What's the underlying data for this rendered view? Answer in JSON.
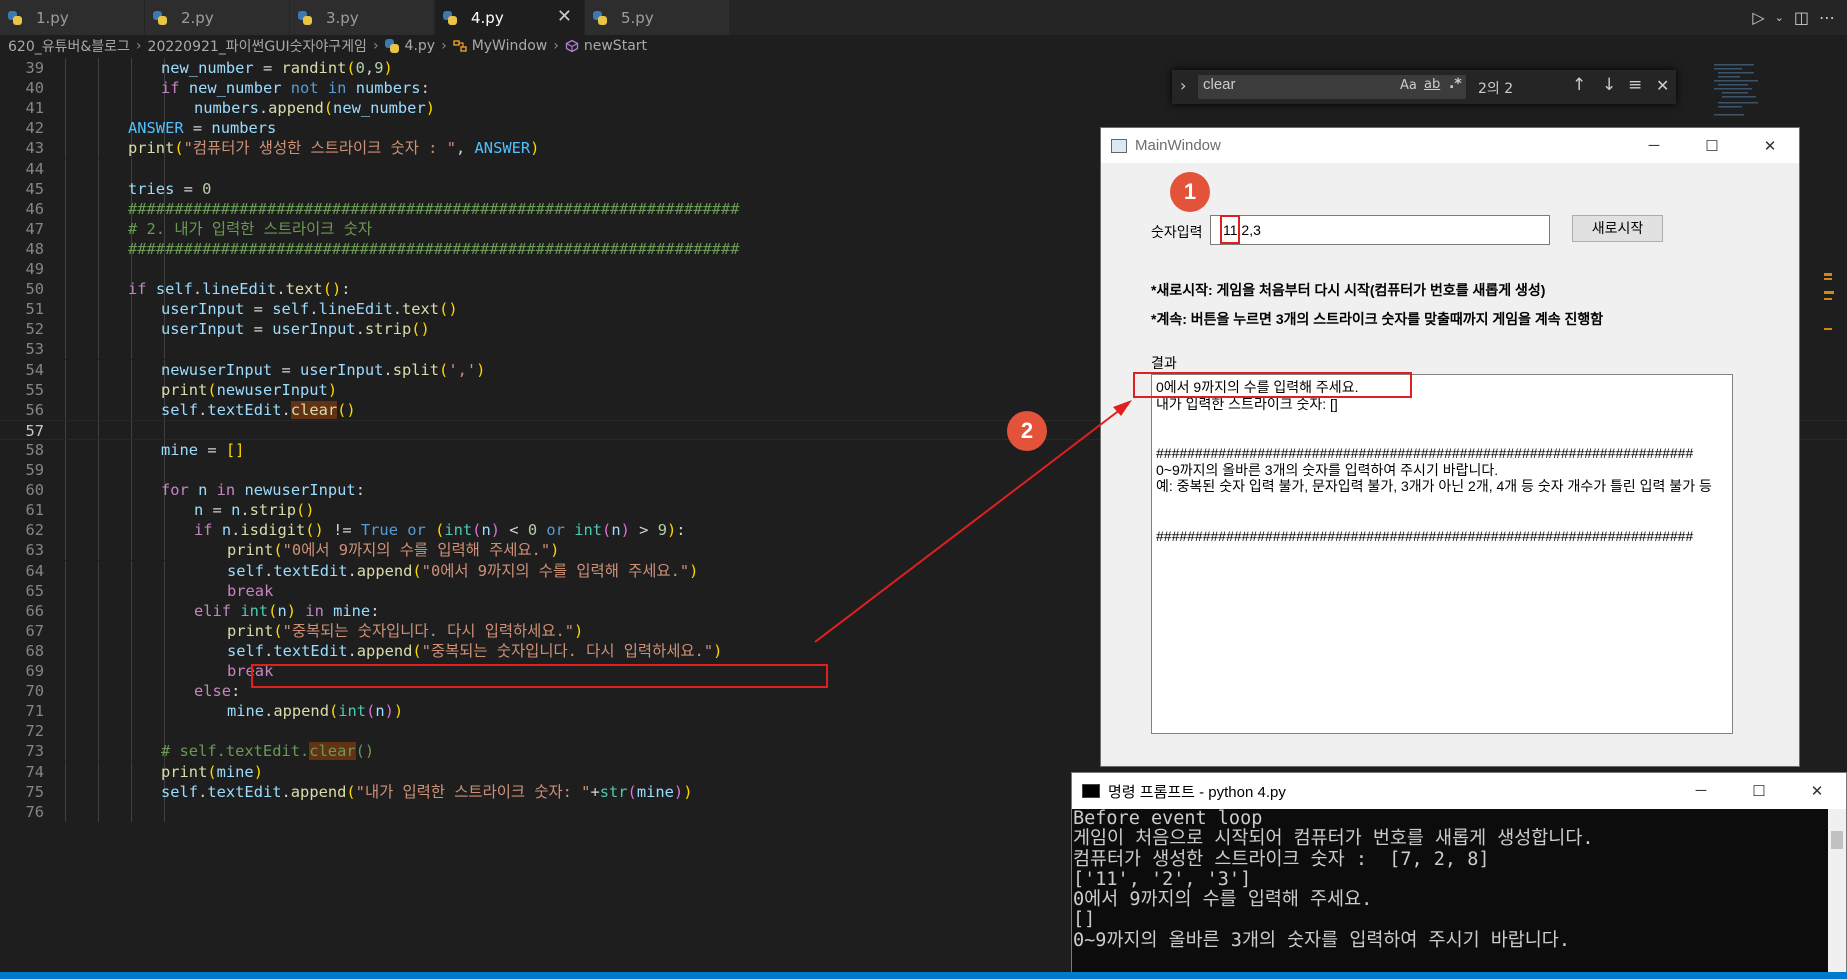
{
  "tabs": [
    {
      "label": "1.py",
      "active": false
    },
    {
      "label": "2.py",
      "active": false
    },
    {
      "label": "3.py",
      "active": false
    },
    {
      "label": "4.py",
      "active": true
    },
    {
      "label": "5.py",
      "active": false
    }
  ],
  "breadcrumb": {
    "folder": "620_유튜버&블로그",
    "subfolder": "20220921_파이썬GUI숫자야구게임",
    "file": "4.py",
    "class": "MyWindow",
    "method": "newStart"
  },
  "find": {
    "query": "clear",
    "match_case": "Aa",
    "whole_word": "ab",
    "regex": ".*",
    "count": "2의 2"
  },
  "qt": {
    "title": "MainWindow",
    "input_label": "숫자입력",
    "input_value": "11,2,3",
    "restart_button": "새로시작",
    "note1": "*새로시작: 게임을 처음부터 다시 시작(컴퓨터가 번호를 새롭게 생성)",
    "note2": "*계속: 버튼을 누르면 3개의 스트라이크 숫자를 맞출때까지 게임을 계속 진행함",
    "result_label": "결과",
    "result_lines": [
      "0에서 9까지의 수를 입력해 주세요.",
      "내가 입력한 스트라이크 숫자: []",
      "",
      "",
      "#####################################################################",
      "0~9까지의 올바른 3개의 숫자를 입력하여 주시기 바랍니다.",
      "예: 중복된 숫자 입력 불가, 문자입력 불가, 3개가 아닌 2개, 4개 등 숫자 개수가 틀린 입력 불가 등",
      "",
      "",
      "#####################################################################"
    ]
  },
  "cmd": {
    "title": "명령 프롬프트 - python  4.py",
    "lines": [
      "Before event loop",
      "게임이 처음으로 시작되어 컴퓨터가 번호를 새롭게 생성합니다.",
      "컴퓨터가 생성한 스트라이크 숫자 :  [7, 2, 8]",
      "['11', '2', '3']",
      "0에서 9까지의 수를 입력해 주세요.",
      "[]",
      "0~9까지의 올바른 3개의 숫자를 입력하여 주시기 바랍니다."
    ]
  },
  "annotations": {
    "badge1": "1",
    "badge2": "2"
  },
  "code_lines": [
    {
      "n": "39",
      "indent": 2,
      "html": "<span class=\"var\">new_number</span> = <span class=\"fn\">randint</span><span class=\"p1\">(</span><span class=\"num\">0</span>,<span class=\"num\">9</span><span class=\"p1\">)</span>"
    },
    {
      "n": "40",
      "indent": 2,
      "html": "<span class=\"kw\">if</span> <span class=\"var\">new_number</span> <span class=\"kw2\">not</span> <span class=\"kw2\">in</span> <span class=\"var\">numbers</span>:"
    },
    {
      "n": "41",
      "indent": 3,
      "html": "<span class=\"var\">numbers</span>.<span class=\"fn\">append</span><span class=\"p1\">(</span><span class=\"var\">new_number</span><span class=\"p1\">)</span>"
    },
    {
      "n": "42",
      "indent": 1,
      "html": "<span class=\"const\">ANSWER</span> = <span class=\"var\">numbers</span>"
    },
    {
      "n": "43",
      "indent": 1,
      "html": "<span class=\"fn\">print</span><span class=\"p1\">(</span><span class=\"str\">\"컴퓨터가 생성한 스트라이크 숫자 : \"</span>, <span class=\"const\">ANSWER</span><span class=\"p1\">)</span>"
    },
    {
      "n": "44",
      "indent": 0,
      "html": ""
    },
    {
      "n": "45",
      "indent": 1,
      "html": "<span class=\"var\">tries</span> = <span class=\"num\">0</span>"
    },
    {
      "n": "46",
      "indent": 1,
      "html": "<span class=\"cmt\">##################################################################</span>"
    },
    {
      "n": "47",
      "indent": 1,
      "html": "<span class=\"cmt\"># 2. 내가 입력한 스트라이크 숫자</span>"
    },
    {
      "n": "48",
      "indent": 1,
      "html": "<span class=\"cmt\">##################################################################</span>"
    },
    {
      "n": "49",
      "indent": 0,
      "html": ""
    },
    {
      "n": "50",
      "indent": 1,
      "html": "<span class=\"kw\">if</span> <span class=\"var\">self</span>.<span class=\"var\">lineEdit</span>.<span class=\"fn\">text</span><span class=\"p1\">()</span>:"
    },
    {
      "n": "51",
      "indent": 2,
      "html": "<span class=\"var\">userInput</span> = <span class=\"var\">self</span>.<span class=\"var\">lineEdit</span>.<span class=\"fn\">text</span><span class=\"p1\">()</span>"
    },
    {
      "n": "52",
      "indent": 2,
      "html": "<span class=\"var\">userInput</span> = <span class=\"var\">userInput</span>.<span class=\"fn\">strip</span><span class=\"p1\">()</span>"
    },
    {
      "n": "53",
      "indent": 0,
      "html": ""
    },
    {
      "n": "54",
      "indent": 2,
      "html": "<span class=\"var\">newuserInput</span> = <span class=\"var\">userInput</span>.<span class=\"fn\">split</span><span class=\"p1\">(</span><span class=\"str\">','</span><span class=\"p1\">)</span>"
    },
    {
      "n": "55",
      "indent": 2,
      "html": "<span class=\"fn\">print</span><span class=\"p1\">(</span><span class=\"var\">newuserInput</span><span class=\"p1\">)</span>"
    },
    {
      "n": "56",
      "indent": 2,
      "html": "<span class=\"var\">self</span>.<span class=\"var\">textEdit</span>.<span class=\"fn hl\">clear</span><span class=\"p1\">()</span>"
    },
    {
      "n": "57",
      "indent": 0,
      "html": "",
      "current": true
    },
    {
      "n": "58",
      "indent": 2,
      "html": "<span class=\"var\">mine</span> = <span class=\"p1\">[]</span>"
    },
    {
      "n": "59",
      "indent": 0,
      "html": ""
    },
    {
      "n": "60",
      "indent": 2,
      "html": "<span class=\"kw\">for</span> <span class=\"var\">n</span> <span class=\"kw\">in</span> <span class=\"var\">newuserInput</span>:"
    },
    {
      "n": "61",
      "indent": 3,
      "html": "<span class=\"var\">n</span> = <span class=\"var\">n</span>.<span class=\"fn\">strip</span><span class=\"p1\">()</span>"
    },
    {
      "n": "62",
      "indent": 3,
      "html": "<span class=\"kw\">if</span> <span class=\"var\">n</span>.<span class=\"fn\">isdigit</span><span class=\"p1\">()</span> != <span class=\"kw2\">True</span> <span class=\"kw2\">or</span> <span class=\"p1\">(</span><span class=\"bi\">int</span><span class=\"p2\">(</span><span class=\"var\">n</span><span class=\"p2\">)</span> &lt; <span class=\"num\">0</span> <span class=\"kw2\">or</span> <span class=\"bi\">int</span><span class=\"p2\">(</span><span class=\"var\">n</span><span class=\"p2\">)</span> &gt; <span class=\"num\">9</span><span class=\"p1\">)</span>:"
    },
    {
      "n": "63",
      "indent": 4,
      "html": "<span class=\"fn\">print</span><span class=\"p1\">(</span><span class=\"str\">\"0에서 9까지의 수를 입력해 주세요.\"</span><span class=\"p1\">)</span>"
    },
    {
      "n": "64",
      "indent": 4,
      "html": "<span class=\"var\">self</span>.<span class=\"var\">textEdit</span>.<span class=\"fn\">append</span><span class=\"p1\">(</span><span class=\"str\">\"0에서 9까지의 수를 입력해 주세요.\"</span><span class=\"p1\">)</span>"
    },
    {
      "n": "65",
      "indent": 4,
      "html": "<span class=\"kw\">break</span>"
    },
    {
      "n": "66",
      "indent": 3,
      "html": "<span class=\"kw\">elif</span> <span class=\"bi\">int</span><span class=\"p1\">(</span><span class=\"var\">n</span><span class=\"p1\">)</span> <span class=\"kw\">in</span> <span class=\"var\">mine</span>:"
    },
    {
      "n": "67",
      "indent": 4,
      "html": "<span class=\"fn\">print</span><span class=\"p1\">(</span><span class=\"str\">\"중복되는 숫자입니다. 다시 입력하세요.\"</span><span class=\"p1\">)</span>"
    },
    {
      "n": "68",
      "indent": 4,
      "html": "<span class=\"var\">self</span>.<span class=\"var\">textEdit</span>.<span class=\"fn\">append</span><span class=\"p1\">(</span><span class=\"str\">\"중복되는 숫자입니다. 다시 입력하세요.\"</span><span class=\"p1\">)</span>"
    },
    {
      "n": "69",
      "indent": 4,
      "html": "<span class=\"kw\">break</span>"
    },
    {
      "n": "70",
      "indent": 3,
      "html": "<span class=\"kw\">else</span>:"
    },
    {
      "n": "71",
      "indent": 4,
      "html": "<span class=\"var\">mine</span>.<span class=\"fn\">append</span><span class=\"p1\">(</span><span class=\"bi\">int</span><span class=\"p2\">(</span><span class=\"var\">n</span><span class=\"p2\">)</span><span class=\"p1\">)</span>"
    },
    {
      "n": "72",
      "indent": 0,
      "html": ""
    },
    {
      "n": "73",
      "indent": 2,
      "html": "<span class=\"cmt\"># self.textEdit.</span><span class=\"cmt hl\">clear</span><span class=\"cmt\">()</span>"
    },
    {
      "n": "74",
      "indent": 2,
      "html": "<span class=\"fn\">print</span><span class=\"p1\">(</span><span class=\"var\">mine</span><span class=\"p1\">)</span>"
    },
    {
      "n": "75",
      "indent": 2,
      "html": "<span class=\"var\">self</span>.<span class=\"var\">textEdit</span>.<span class=\"fn\">append</span><span class=\"p1\">(</span><span class=\"str\">\"내가 입력한 스트라이크 숫자: \"</span>+<span class=\"bi\">str</span><span class=\"p2\">(</span><span class=\"var\">mine</span><span class=\"p2\">)</span><span class=\"p1\">)</span>"
    },
    {
      "n": "76",
      "indent": 0,
      "html": ""
    }
  ]
}
